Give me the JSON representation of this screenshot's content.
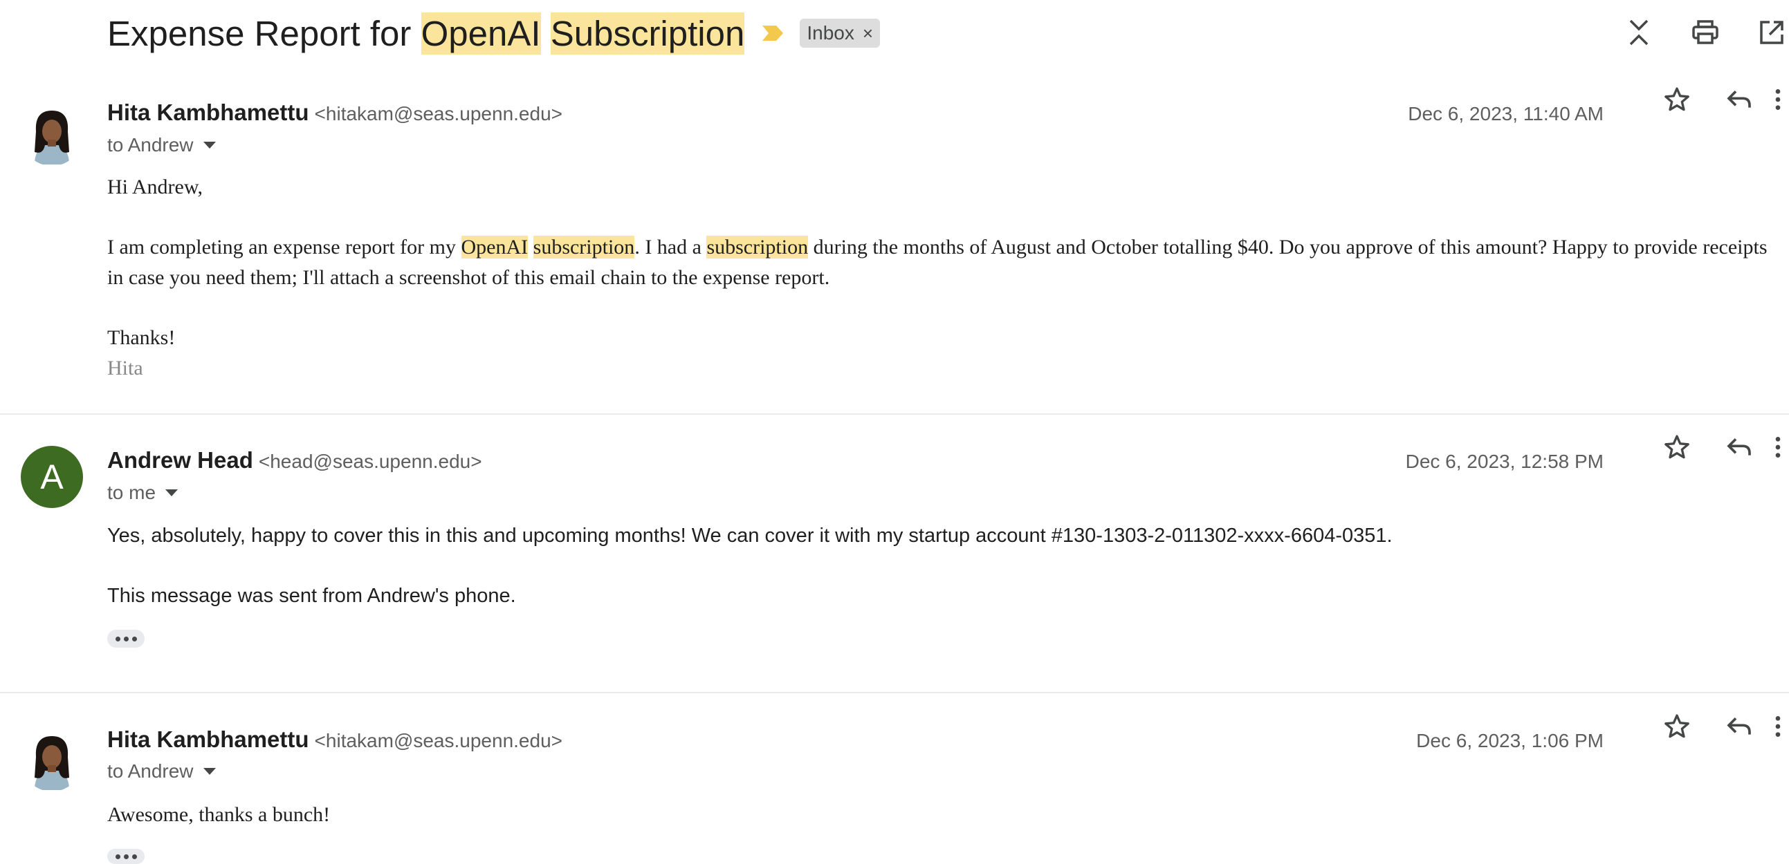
{
  "thread": {
    "subject_parts": [
      {
        "text": "Expense Report for ",
        "highlight": false
      },
      {
        "text": "OpenAI",
        "highlight": true
      },
      {
        "text": " ",
        "highlight": false
      },
      {
        "text": "Subscription",
        "highlight": true
      }
    ],
    "label": "Inbox",
    "label_remove": "×",
    "importance_color": "#f2c94c",
    "highlight_color": "#fbe59c",
    "top_icons": [
      "collapse-all-icon",
      "print-icon",
      "open-in-new-window-icon"
    ]
  },
  "messages": [
    {
      "sender_name": "Hita Kambhamettu",
      "sender_email": "<hitakam@seas.upenn.edu>",
      "to": "to Andrew",
      "date": "Dec 6, 2023, 11:40 AM",
      "avatar": "photo",
      "body": {
        "greeting": "Hi Andrew,",
        "p1": [
          {
            "text": "I am completing an expense report for my ",
            "highlight": false
          },
          {
            "text": "OpenAI",
            "highlight": true
          },
          {
            "text": " ",
            "highlight": false
          },
          {
            "text": "subscription",
            "highlight": true
          },
          {
            "text": ". I had a ",
            "highlight": false
          },
          {
            "text": "subscription",
            "highlight": true
          },
          {
            "text": " during the months of August and October totalling $40. Do you approve of this amount? Happy to provide receipts in case you need them; I'll attach a screenshot of this email chain to the expense report.",
            "highlight": false
          }
        ],
        "closing": "Thanks!",
        "signature": "Hita"
      }
    },
    {
      "sender_name": "Andrew Head",
      "sender_email": "<head@seas.upenn.edu>",
      "to": "to me",
      "date": "Dec 6, 2023, 12:58 PM",
      "avatar": "letter",
      "avatar_letter": "A",
      "avatar_color": "#3e6b22",
      "body": {
        "p1": "Yes, absolutely, happy to cover this in this and upcoming months! We can cover it with my startup account #130-1303-2-011302-xxxx-6604-0351.",
        "p2": "This message was sent from Andrew's phone."
      }
    },
    {
      "sender_name": "Hita Kambhamettu",
      "sender_email": "<hitakam@seas.upenn.edu>",
      "to": "to Andrew",
      "date": "Dec 6, 2023, 1:06 PM",
      "avatar": "photo",
      "body": {
        "p1": "Awesome, thanks a bunch!"
      }
    }
  ]
}
